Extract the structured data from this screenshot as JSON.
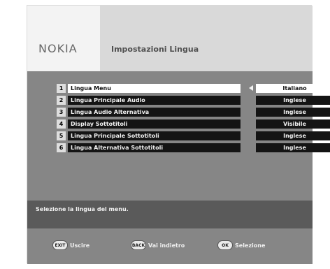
{
  "header": {
    "brand": "NOKIA",
    "title": "Impostazioni Lingua"
  },
  "menu": {
    "items": [
      {
        "num": "1",
        "label": "Lingua Menu",
        "value": "Italiano",
        "selected": true
      },
      {
        "num": "2",
        "label": "Lingua Principale Audio",
        "value": "Inglese",
        "selected": false
      },
      {
        "num": "3",
        "label": "Lingua Audio Alternativa",
        "value": "Inglese",
        "selected": false
      },
      {
        "num": "4",
        "label": "Display Sottotitoli",
        "value": "Visibile",
        "selected": false
      },
      {
        "num": "5",
        "label": "Lingua Principale Sottotitoli",
        "value": "Inglese",
        "selected": false
      },
      {
        "num": "6",
        "label": "Lingua Alternativa Sottotitoli",
        "value": "Inglese",
        "selected": false
      }
    ]
  },
  "help": {
    "text": "Selezione la lingua del menu."
  },
  "footer": {
    "exit": {
      "key": "EXIT",
      "label": "Uscire"
    },
    "back": {
      "key": "BACK",
      "label": "Vai indietro"
    },
    "ok": {
      "key": "OK",
      "label": "Selezione"
    }
  }
}
